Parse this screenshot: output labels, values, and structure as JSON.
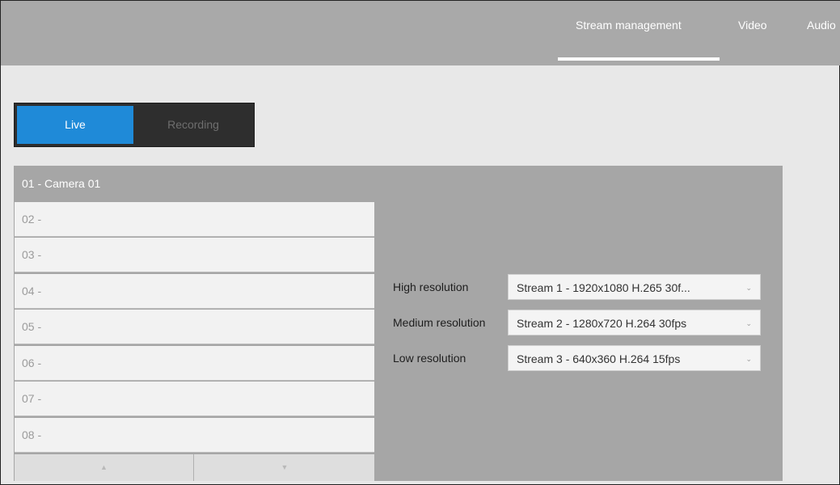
{
  "header": {
    "nav": [
      {
        "label": "Stream management",
        "active": true
      },
      {
        "label": "Video",
        "active": false
      },
      {
        "label": "Audio",
        "active": false
      }
    ]
  },
  "mode_toggle": {
    "options": [
      "Live",
      "Recording"
    ],
    "selected": "Live"
  },
  "cameras": {
    "selected": "01 - Camera 01",
    "items": [
      "02 -",
      "03 -",
      "04 -",
      "05 -",
      "06 -",
      "07 -",
      "08 -"
    ],
    "pager": {
      "up_icon": "▲",
      "down_icon": "▼"
    }
  },
  "streams": {
    "high": {
      "label": "High resolution",
      "value": "Stream 1 - 1920x1080 H.265 30f..."
    },
    "medium": {
      "label": "Medium resolution",
      "value": "Stream 2 - 1280x720 H.264 30fps"
    },
    "low": {
      "label": "Low resolution",
      "value": "Stream 3 - 640x360 H.264 15fps"
    },
    "chevron": "⌄"
  },
  "colors": {
    "accent": "#1f8ad8",
    "topbar": "#a9a9a9",
    "panel": "#a6a6a6"
  }
}
